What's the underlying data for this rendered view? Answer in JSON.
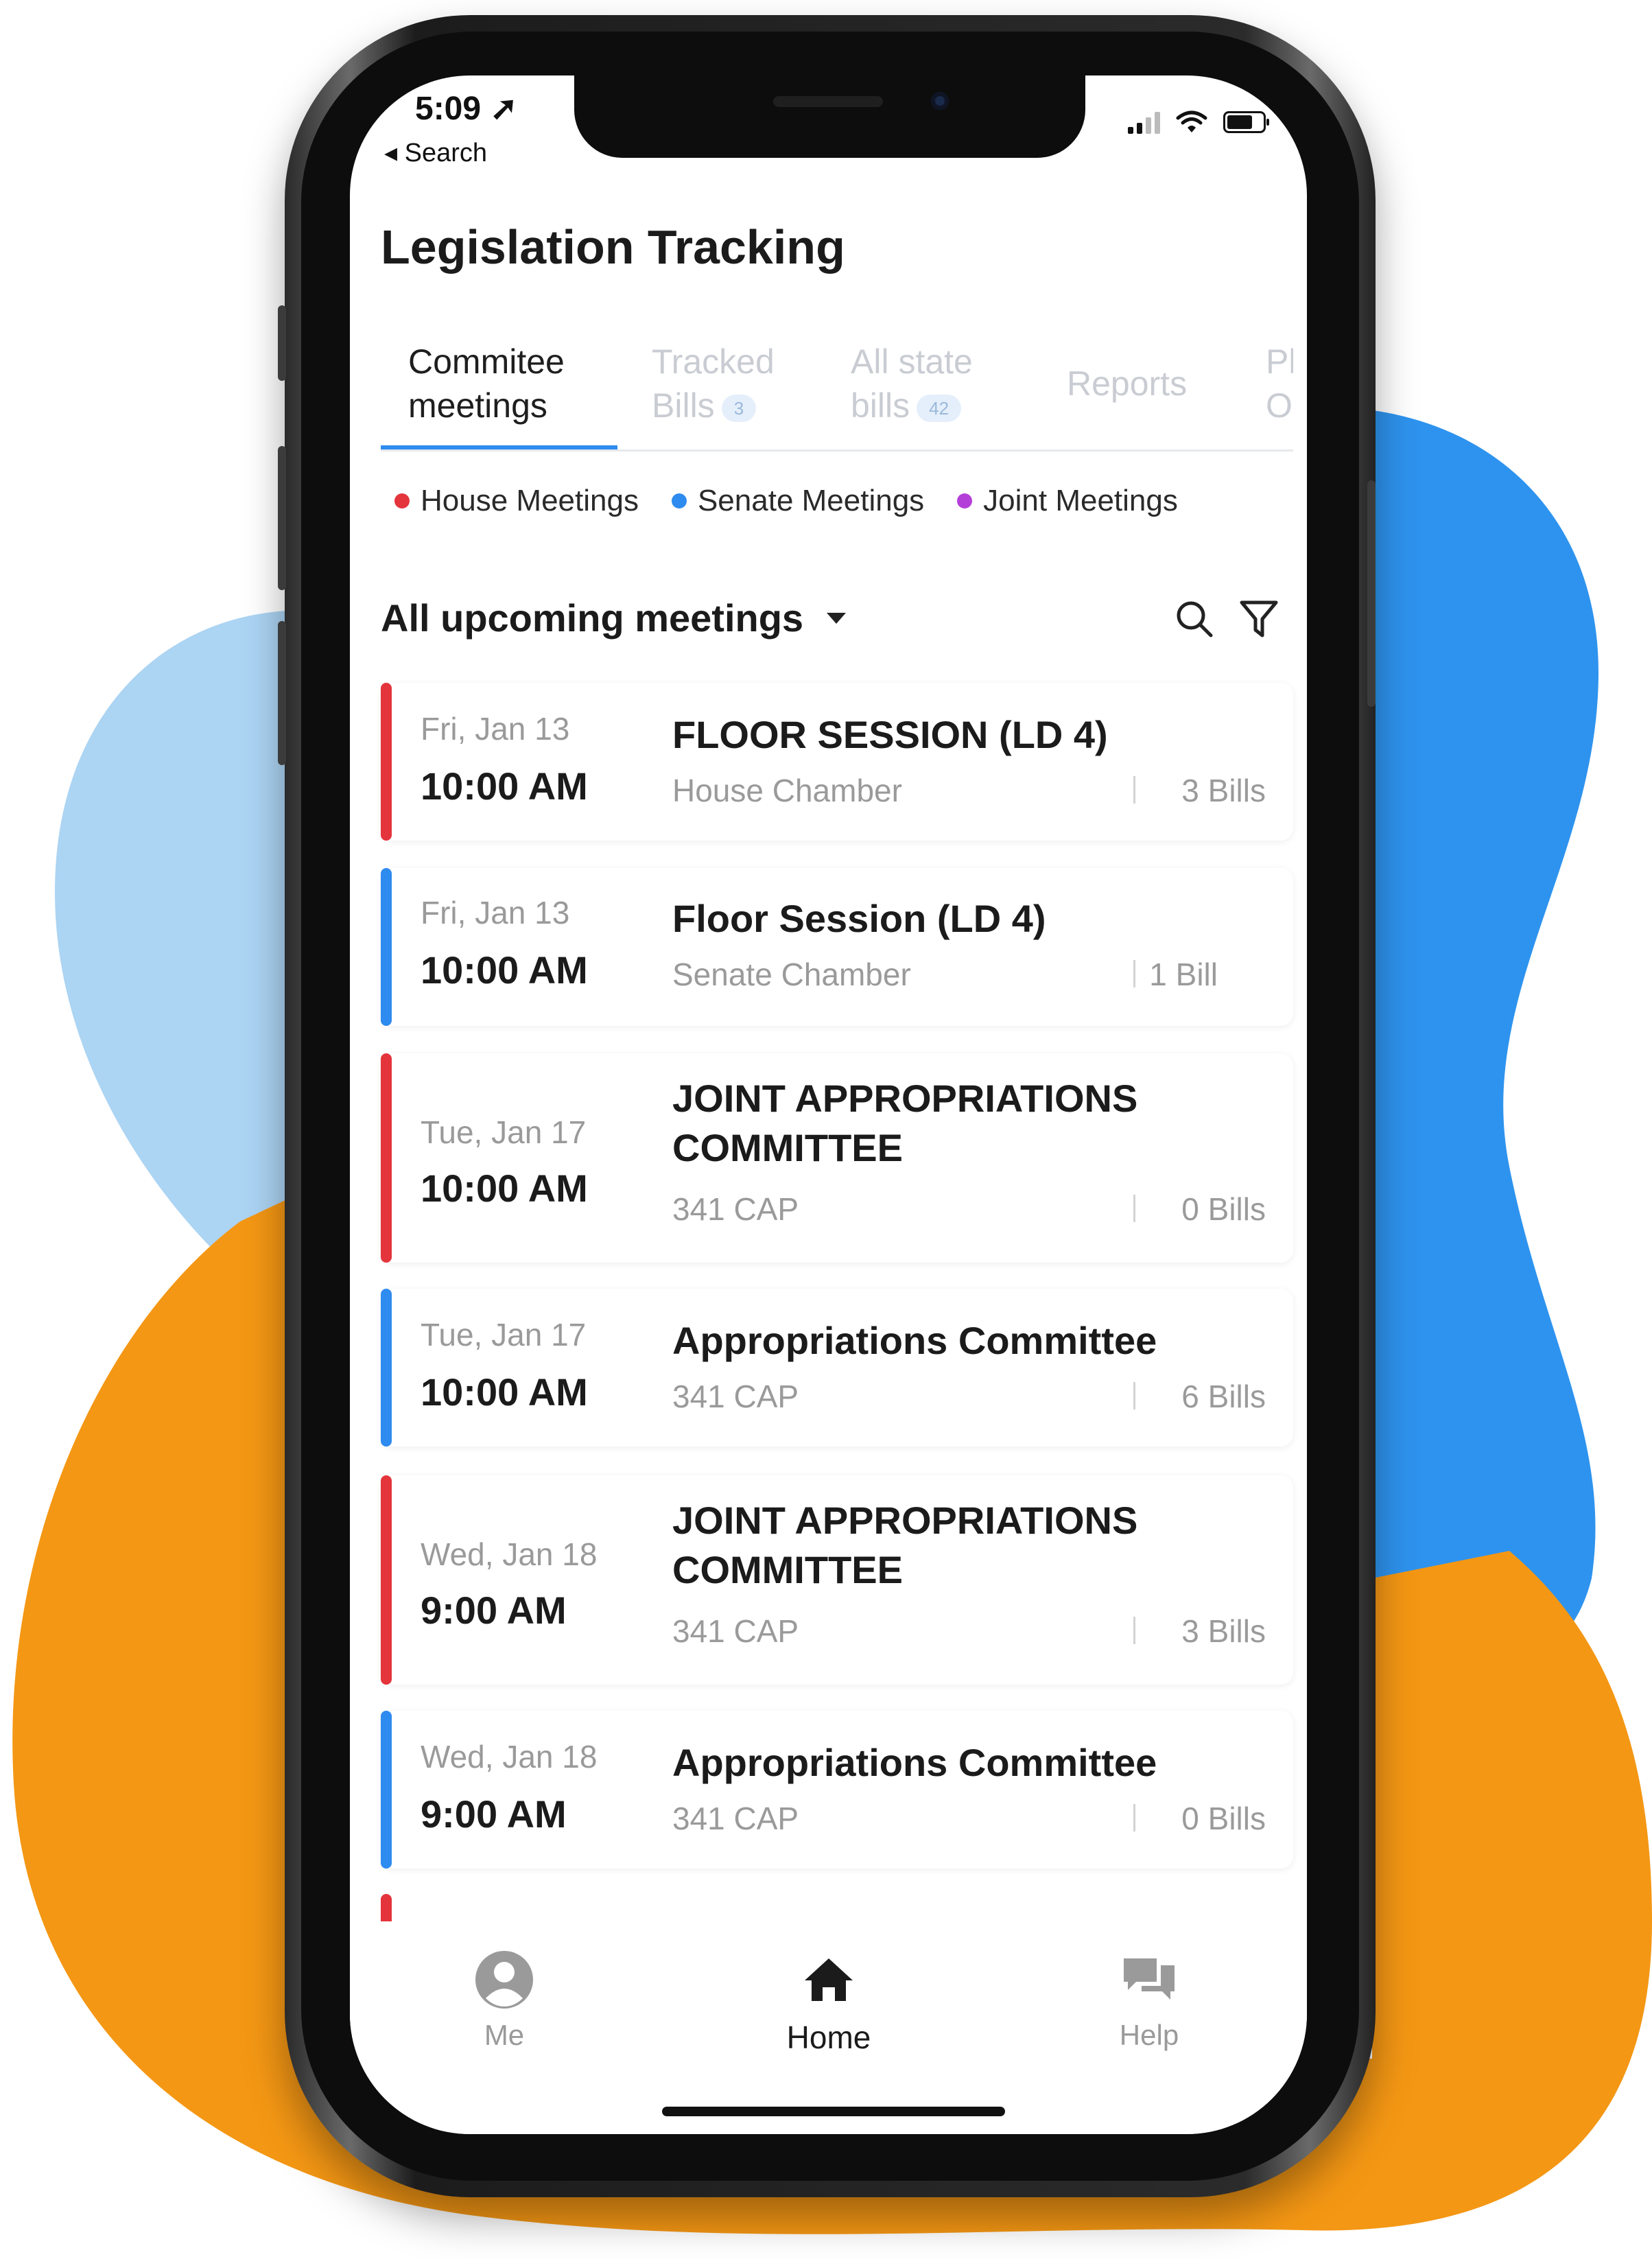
{
  "status_bar": {
    "time": "5:09 ➚",
    "back_label": "◂ Search"
  },
  "app": {
    "title": "Legislation Tracking"
  },
  "tabs": [
    {
      "label_line1": "Commitee",
      "label_line2": "meetings",
      "badge": ""
    },
    {
      "label_line1": "Tracked",
      "label_line2": "Bills",
      "badge": "3"
    },
    {
      "label_line1": "All state",
      "label_line2": "bills",
      "badge": "42"
    },
    {
      "label_line1": "Reports",
      "label_line2": "",
      "badge": ""
    },
    {
      "label_line1": "Pl",
      "label_line2": "O",
      "badge": ""
    }
  ],
  "legend": [
    {
      "label": "House Meetings",
      "color": "#e4343c"
    },
    {
      "label": "Senate Meetings",
      "color": "#2e8bef"
    },
    {
      "label": "Joint Meetings",
      "color": "#b43fd8"
    }
  ],
  "section": {
    "filter_label": "All upcoming meetings"
  },
  "meetings": [
    {
      "date": "Fri, Jan 13",
      "time": "10:00 AM",
      "title": "FLOOR SESSION (LD 4)",
      "room": "House Chamber",
      "bills": "3 Bills",
      "color": "#e4343c"
    },
    {
      "date": "Fri, Jan 13",
      "time": "10:00 AM",
      "title": "Floor Session (LD 4)",
      "room": "Senate Chamber",
      "bills": "1 Bill",
      "color": "#2e8bef"
    },
    {
      "date": "Tue, Jan 17",
      "time": "10:00 AM",
      "title": "JOINT APPROPRIATIONS COMMITTEE",
      "room": "341 CAP",
      "bills": "0 Bills",
      "color": "#e4343c"
    },
    {
      "date": "Tue, Jan 17",
      "time": "10:00 AM",
      "title": "Appropriations Committee",
      "room": "341 CAP",
      "bills": "6 Bills",
      "color": "#2e8bef"
    },
    {
      "date": "Wed, Jan 18",
      "time": "9:00 AM",
      "title": "JOINT APPROPRIATIONS COMMITTEE",
      "room": "341 CAP",
      "bills": "3 Bills",
      "color": "#e4343c"
    },
    {
      "date": "Wed, Jan 18",
      "time": "9:00 AM",
      "title": "Appropriations Committee",
      "room": "341 CAP",
      "bills": "0 Bills",
      "color": "#2e8bef"
    }
  ],
  "bottom_nav": [
    {
      "label": "Me",
      "icon": "user-circle-icon"
    },
    {
      "label": "Home",
      "icon": "home-icon"
    },
    {
      "label": "Help",
      "icon": "chat-bubbles-icon"
    }
  ],
  "colors": {
    "accent": "#2e8bef",
    "house": "#e4343c",
    "senate": "#2e8bef",
    "joint": "#b43fd8",
    "blob_orange": "#f49714",
    "blob_blue": "#2e93ee",
    "blob_light_blue": "#acd4f3"
  }
}
